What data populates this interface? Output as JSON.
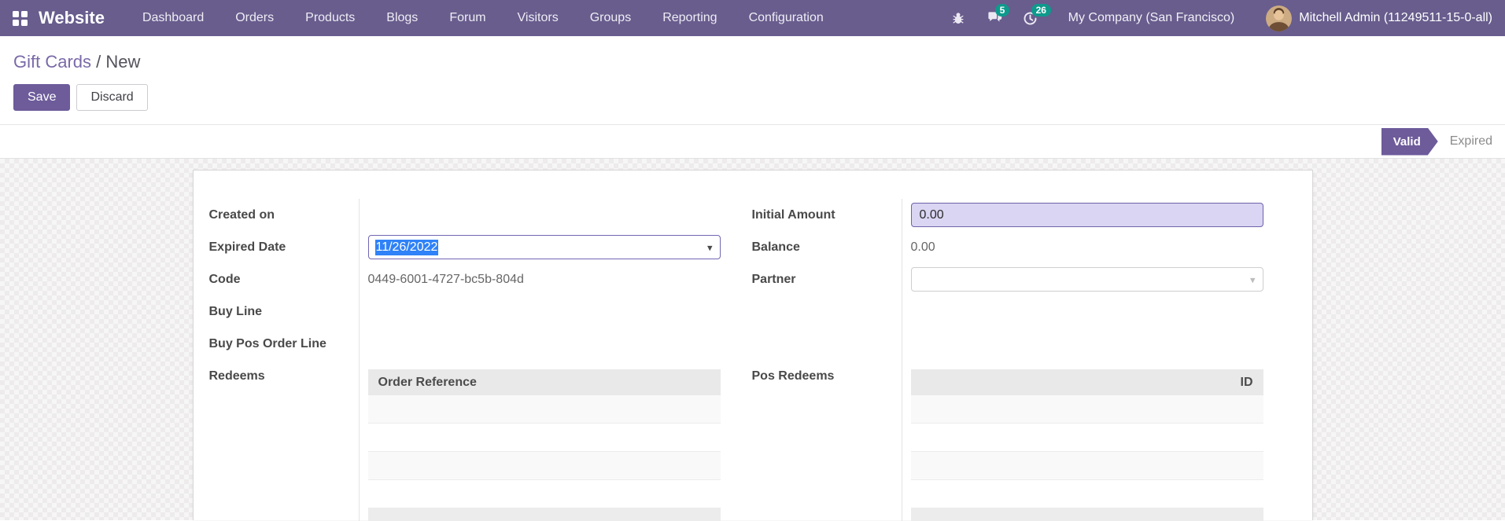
{
  "navbar": {
    "brand": "Website",
    "menu": [
      "Dashboard",
      "Orders",
      "Products",
      "Blogs",
      "Forum",
      "Visitors",
      "Groups",
      "Reporting",
      "Configuration"
    ],
    "messages_count": "5",
    "activities_count": "26",
    "company": "My Company (San Francisco)",
    "user": "Mitchell Admin (11249511-15-0-all)",
    "icons": {
      "apps": "grid-icon",
      "debug": "bug-icon",
      "messages": "chat-bubbles-icon",
      "activities": "clock-icon"
    }
  },
  "breadcrumb": {
    "parent": "Gift Cards",
    "separator": " / ",
    "current": "New"
  },
  "actions": {
    "save": "Save",
    "discard": "Discard"
  },
  "statusbar": {
    "active": "Valid",
    "inactive": "Expired"
  },
  "form": {
    "left": {
      "created_on_label": "Created on",
      "created_on_value": "",
      "expired_date_label": "Expired Date",
      "expired_date_value": "11/26/2022",
      "code_label": "Code",
      "code_value": "0449-6001-4727-bc5b-804d",
      "buy_line_label": "Buy Line",
      "buy_pos_order_line_label": "Buy Pos Order Line",
      "redeems_label": "Redeems",
      "redeems_table": {
        "header": "Order Reference",
        "rows": [
          "",
          "",
          "",
          ""
        ]
      }
    },
    "right": {
      "initial_amount_label": "Initial Amount",
      "initial_amount_value": "0.00",
      "balance_label": "Balance",
      "balance_value": "0.00",
      "partner_label": "Partner",
      "partner_value": "",
      "pos_redeems_label": "Pos Redeems",
      "pos_redeems_table": {
        "header": "ID",
        "rows": [
          "",
          "",
          "",
          ""
        ]
      }
    }
  },
  "colors": {
    "navbar_bg": "#685d8d",
    "accent": "#6d5b9a",
    "badge": "#0d9a8c",
    "breadcrumb_link": "#7a6aa8",
    "selection": "#2f82f7",
    "highlight_field_bg": "#d9d5f2",
    "table_header_bg": "#e9e9e9"
  }
}
